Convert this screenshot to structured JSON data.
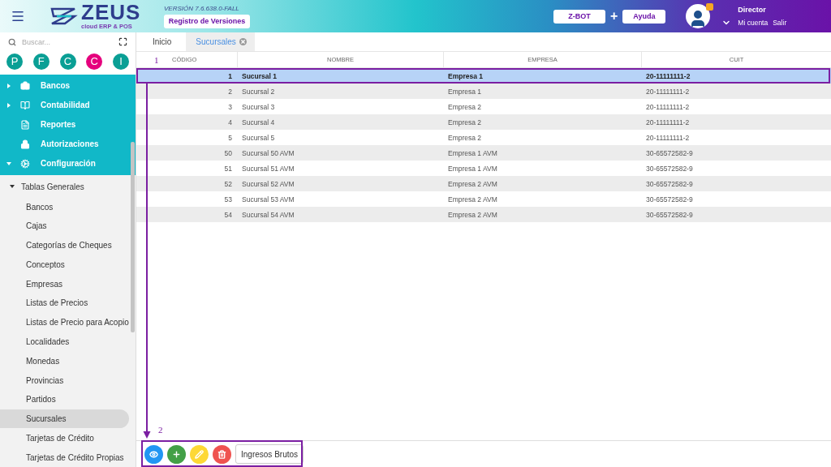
{
  "header": {
    "logo": {
      "name": "ZEUS",
      "tagline": "cloud ERP & POS"
    },
    "version": "VERSIÓN 7.6.638.0-FALL",
    "changelog_button": "Registro de Versiones",
    "zbot_button": "Z-BOT",
    "plus": "+",
    "help_button": "Ayuda",
    "user": {
      "name": "Director",
      "links": [
        "Mi cuenta",
        "Salir"
      ]
    }
  },
  "sidebar": {
    "search": {
      "placeholder": "Buscar..."
    },
    "shortcuts": [
      {
        "letter": "P",
        "color": "#0a9f95"
      },
      {
        "letter": "F",
        "color": "#0a9f95"
      },
      {
        "letter": "C",
        "color": "#0a9f95"
      },
      {
        "letter": "C",
        "color": "#e5007d"
      },
      {
        "letter": "I",
        "color": "#0a9f95"
      }
    ],
    "menu": [
      {
        "label": "Bancos",
        "kind": "folder",
        "expanded": false
      },
      {
        "label": "Contabilidad",
        "kind": "folder",
        "expanded": false
      },
      {
        "label": "Reportes",
        "kind": "page"
      },
      {
        "label": "Autorizaciones",
        "kind": "page"
      },
      {
        "label": "Configuración",
        "kind": "folder",
        "expanded": true,
        "children": [
          {
            "label": "Tablas Generales",
            "expanded": true,
            "children": [
              {
                "label": "Bancos",
                "selected": false
              },
              {
                "label": "Cajas",
                "selected": false
              },
              {
                "label": "Categorías de Cheques",
                "selected": false
              },
              {
                "label": "Conceptos",
                "selected": false
              },
              {
                "label": "Empresas",
                "selected": false
              },
              {
                "label": "Listas de Precios",
                "selected": false
              },
              {
                "label": "Listas de Precio para Acopio",
                "selected": false
              },
              {
                "label": "Localidades",
                "selected": false
              },
              {
                "label": "Monedas",
                "selected": false
              },
              {
                "label": "Provincias",
                "selected": false
              },
              {
                "label": "Partidos",
                "selected": false
              },
              {
                "label": "Sucursales",
                "selected": true
              },
              {
                "label": "Tarjetas de Crédito",
                "selected": false
              },
              {
                "label": "Tarjetas de Crédito Propias",
                "selected": false
              }
            ]
          }
        ]
      }
    ]
  },
  "tabs": [
    {
      "label": "Inicio",
      "selected": false
    },
    {
      "label": "Sucursales",
      "selected": true,
      "closable": true
    }
  ],
  "table": {
    "columns": [
      "CÓDIGO",
      "NOMBRE",
      "EMPRESA",
      "CUIT"
    ],
    "rows": [
      {
        "cells": [
          "1",
          "Sucursal 1",
          "Empresa 1",
          "20-11111111-2"
        ],
        "selected": true
      },
      {
        "cells": [
          "2",
          "Sucursal 2",
          "Empresa 1",
          "20-11111111-2"
        ],
        "selected": false
      },
      {
        "cells": [
          "3",
          "Sucursal 3",
          "Empresa 2",
          "20-11111111-2"
        ],
        "selected": false
      },
      {
        "cells": [
          "4",
          "Sucursal 4",
          "Empresa 2",
          "20-11111111-2"
        ],
        "selected": false
      },
      {
        "cells": [
          "5",
          "Sucursal 5",
          "Empresa 2",
          "20-11111111-2"
        ],
        "selected": false
      },
      {
        "cells": [
          "50",
          "Sucursal 50 AVM",
          "Empresa 1 AVM",
          "30-65572582-9"
        ],
        "selected": false
      },
      {
        "cells": [
          "51",
          "Sucursal 51 AVM",
          "Empresa 1 AVM",
          "30-65572582-9"
        ],
        "selected": false
      },
      {
        "cells": [
          "52",
          "Sucursal 52 AVM",
          "Empresa 2 AVM",
          "30-65572582-9"
        ],
        "selected": false
      },
      {
        "cells": [
          "53",
          "Sucursal 53 AVM",
          "Empresa 2 AVM",
          "30-65572582-9"
        ],
        "selected": false
      },
      {
        "cells": [
          "54",
          "Sucursal 54 AVM",
          "Empresa 2 AVM",
          "30-65572582-9"
        ],
        "selected": false
      }
    ]
  },
  "toolbar": [
    {
      "kind": "view"
    },
    {
      "kind": "add"
    },
    {
      "kind": "edit"
    },
    {
      "kind": "delete"
    },
    {
      "kind": "text",
      "label": "Ingresos Brutos"
    }
  ],
  "annotations": [
    {
      "label": "1"
    },
    {
      "label": "2"
    }
  ]
}
